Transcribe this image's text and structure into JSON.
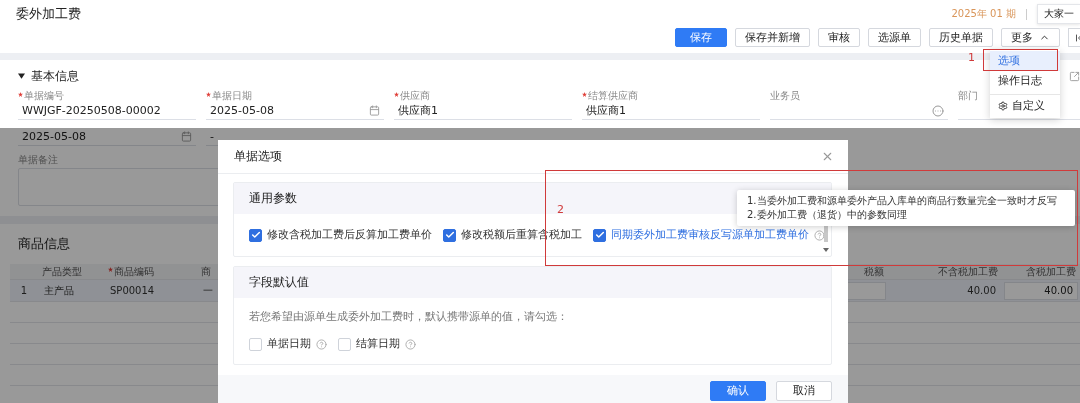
{
  "header": {
    "title": "委外加工费",
    "period": "2025年 01 期",
    "organization": "大家一"
  },
  "toolbar": {
    "buttons": [
      {
        "label": "保存",
        "kind": "primary"
      },
      {
        "label": "保存并新增",
        "kind": "default"
      },
      {
        "label": "审核",
        "kind": "default"
      },
      {
        "label": "选源单",
        "kind": "default"
      },
      {
        "label": "历史单据",
        "kind": "default"
      }
    ],
    "more": {
      "label": "更多",
      "expanded": true
    }
  },
  "more_menu": [
    {
      "label": "选项",
      "selected": true,
      "kind": "item"
    },
    {
      "label": "操作日志",
      "selected": false,
      "kind": "item"
    },
    {
      "label": "自定义",
      "selected": false,
      "kind": "custom"
    }
  ],
  "basic_info": {
    "title": "基本信息",
    "expanded": true,
    "fields": [
      {
        "label": "单据编号",
        "required": true,
        "value": "WWJGF-20250508-00002",
        "kind": "text"
      },
      {
        "label": "单据日期",
        "required": true,
        "value": "2025-05-08",
        "kind": "date"
      },
      {
        "label": "供应商",
        "required": true,
        "value": "供应商1",
        "kind": "text"
      },
      {
        "label": "结算供应商",
        "required": true,
        "value": "供应商1",
        "kind": "text"
      },
      {
        "label": "业务员",
        "required": false,
        "kind": "lookup"
      },
      {
        "label": "部门",
        "required": false,
        "kind": "text"
      }
    ],
    "second_row": [
      {
        "value": "2025-05-08",
        "kind": "date"
      },
      {
        "value": "-",
        "kind": "text"
      }
    ],
    "remark": {
      "label": "单据备注"
    }
  },
  "goods": {
    "title": "商品信息",
    "columns": [
      {
        "label": "产品类型",
        "required": false
      },
      {
        "label": "商品编码",
        "required": true
      },
      {
        "label": "商",
        "required": false
      },
      {
        "label": "税额",
        "required": false
      },
      {
        "label": "不含税加工费",
        "required": false
      },
      {
        "label": "含税加工费",
        "required": false
      }
    ],
    "rows": [
      {
        "index": "1",
        "cells": [
          {
            "kind": "text",
            "value": "主产品"
          },
          {
            "kind": "text",
            "value": "SP00014"
          },
          {
            "kind": "text",
            "value": "一"
          },
          {
            "kind": "input"
          },
          {
            "kind": "text",
            "value": "40.00"
          },
          {
            "kind": "input",
            "value": "40.00"
          }
        ]
      }
    ]
  },
  "dialog": {
    "title": "单据选项",
    "sections": [
      {
        "title": "通用参数",
        "options": [
          {
            "label": "修改含税加工费后反算加工费单价",
            "checked": true,
            "hovered": false,
            "help": false
          },
          {
            "label": "修改税额后重算含税加工",
            "checked": true,
            "hovered": false,
            "help": false
          },
          {
            "label": "同期委外加工费审核反写源单加工费单价",
            "checked": true,
            "hovered": true,
            "help": true
          }
        ]
      },
      {
        "title": "字段默认值",
        "hint": "若您希望由源单生成委外加工费时，默认携带源单的值，请勾选：",
        "options": [
          {
            "label": "单据日期",
            "checked": false,
            "hovered": false,
            "help": true
          },
          {
            "label": "结算日期",
            "checked": false,
            "hovered": false,
            "help": true
          }
        ]
      }
    ],
    "tooltip": [
      "1.当委外加工费和源单委外产品入库单的商品行数量完全一致时才反写",
      "2.委外加工费（退货）中的参数同理"
    ],
    "buttons": [
      {
        "label": "确认",
        "kind": "primary"
      },
      {
        "label": "取消",
        "kind": "default"
      }
    ]
  },
  "annotations": [
    {
      "label": "1"
    },
    {
      "label": "2"
    }
  ]
}
